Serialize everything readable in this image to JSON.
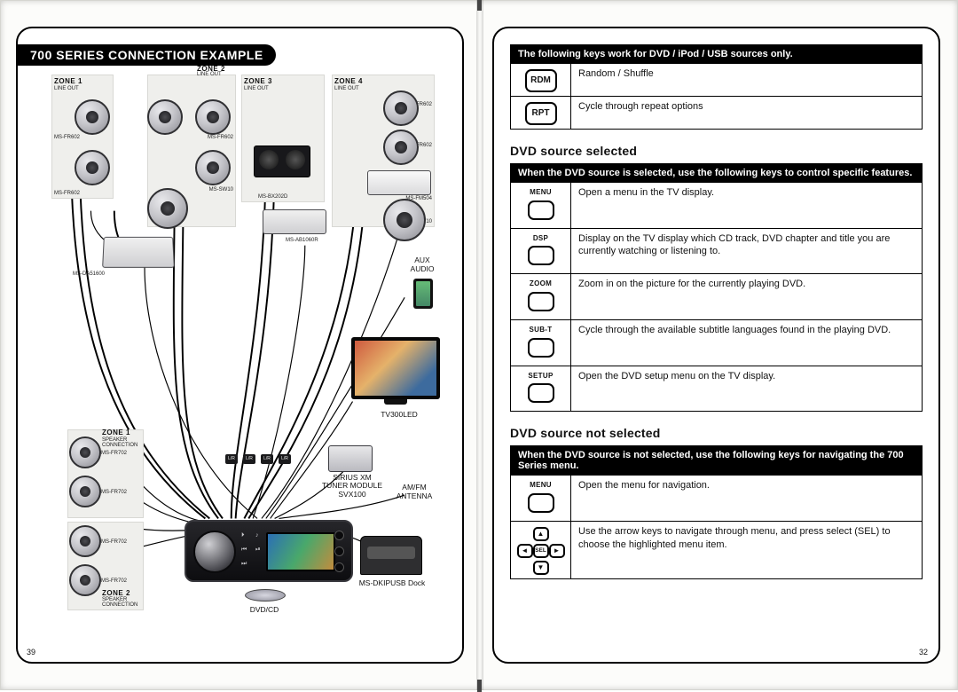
{
  "left": {
    "title": "700 SERIES CONNECTION EXAMPLE",
    "pageNumber": "39",
    "zones": {
      "zone1_top": "ZONE 1",
      "zone1_sub": "LINE OUT",
      "zone2_top": "ZONE 2",
      "zone2_sub": "LINE OUT",
      "zone3_top": "ZONE 3",
      "zone3_sub": "LINE OUT",
      "zone4_top": "ZONE 4",
      "zone4_sub": "LINE OUT",
      "zone1_bottom": "ZONE 1",
      "zone1_bottom_sub": "SPEAKER\nCONNECTION",
      "zone2_bottom": "ZONE 2",
      "zone2_bottom_sub": "SPEAKER\nCONNECTION"
    },
    "labels": {
      "msfr602_1": "MS-FR602",
      "msfr602_2": "MS-FR602",
      "msfr602_3": "MS-FR602",
      "msfr602_4": "MS-FR602",
      "msfr602_5": "MS-FR602",
      "msfr602_6": "MS-FR602",
      "mssw10_1": "MS-SW10",
      "mssw10_2": "MS-SW10",
      "msbx202d": "MS-BX202D",
      "msfm504": "MS-FM504",
      "msda51600": "MS-DA51600",
      "msab1060r": "MS-AB1060R",
      "msfr702_1": "MS-FR702",
      "msfr702_2": "MS-FR702",
      "msfr702_3": "MS-FR702",
      "msfr702_4": "MS-FR702",
      "auxaudio": "AUX\nAUDIO",
      "tvcaption": "TV300LED",
      "sirius": "SIRIUS XM\nTUNER MODULE\nSVX100",
      "amfm": "AM/FM\nANTENNA",
      "dock": "MS-DKIPUSB Dock",
      "dvdcd": "DVD/CD",
      "lr": "L/R"
    }
  },
  "right": {
    "pageNumber": "32",
    "table1": {
      "header": "The following keys work for DVD / iPod / USB sources only.",
      "rows": [
        {
          "key": "RDM",
          "desc": "Random / Shuffle"
        },
        {
          "key": "RPT",
          "desc": "Cycle through repeat options"
        }
      ]
    },
    "sectionA": "DVD source selected",
    "table2": {
      "header": "When the DVD source is selected, use the following keys to control specific features.",
      "rows": [
        {
          "label": "MENU",
          "desc": "Open a menu in the TV display."
        },
        {
          "label": "DSP",
          "desc": "Display on the TV display which CD track, DVD chapter and title you are currently watching or listening to."
        },
        {
          "label": "ZOOM",
          "desc": "Zoom in on the picture for the currently playing DVD."
        },
        {
          "label": "SUB-T",
          "desc": "Cycle through the available subtitle languages found in the playing DVD."
        },
        {
          "label": "SETUP",
          "desc": "Open the DVD setup menu on the TV display."
        }
      ]
    },
    "sectionB": "DVD source not selected",
    "table3": {
      "header": "When the DVD source is not selected, use the following keys for navigating the 700 Series menu.",
      "rows": [
        {
          "label": "MENU",
          "desc": "Open the menu for navigation."
        },
        {
          "label": "dpad",
          "desc": "Use the arrow keys to navigate through menu, and press select (SEL) to choose the highlighted menu item."
        }
      ]
    },
    "dpad": {
      "up": "▲",
      "down": "▼",
      "left": "◄",
      "right": "►",
      "sel": "SEL"
    }
  }
}
